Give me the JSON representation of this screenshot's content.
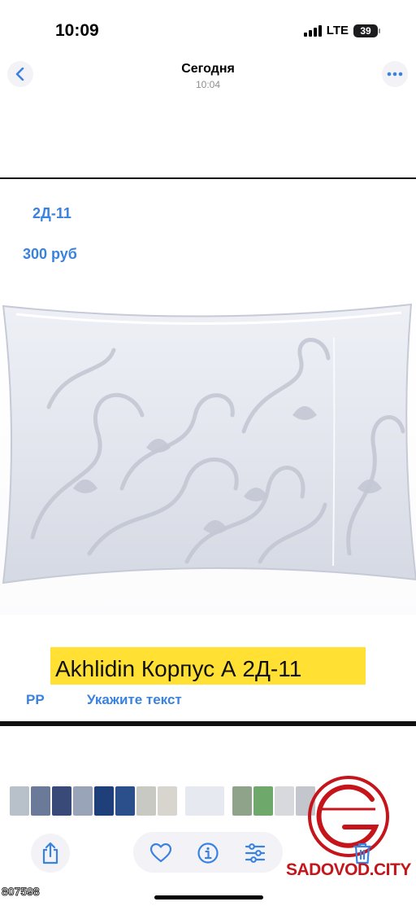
{
  "status_bar": {
    "time": "10:09",
    "network": "LTE",
    "battery": "39"
  },
  "header": {
    "title": "Сегодня",
    "subtitle": "10:04"
  },
  "messages": {
    "line1": "2Д-11",
    "line2": "300 руб"
  },
  "product": {
    "caption": "Akhlidin Корпус А 2Д-11",
    "caption_highlight_color": "#ffe033"
  },
  "reply": {
    "label": "РР",
    "placeholder": "Укажите текст"
  },
  "toolbar": {
    "icons": [
      "share-icon",
      "heart-icon",
      "info-icon",
      "adjust-icon",
      "trash-icon"
    ],
    "accent_color": "#3a82e0"
  },
  "watermark": {
    "brand": "SADOVOD.CITY",
    "code": "807598",
    "brand_color": "#c5151b"
  }
}
